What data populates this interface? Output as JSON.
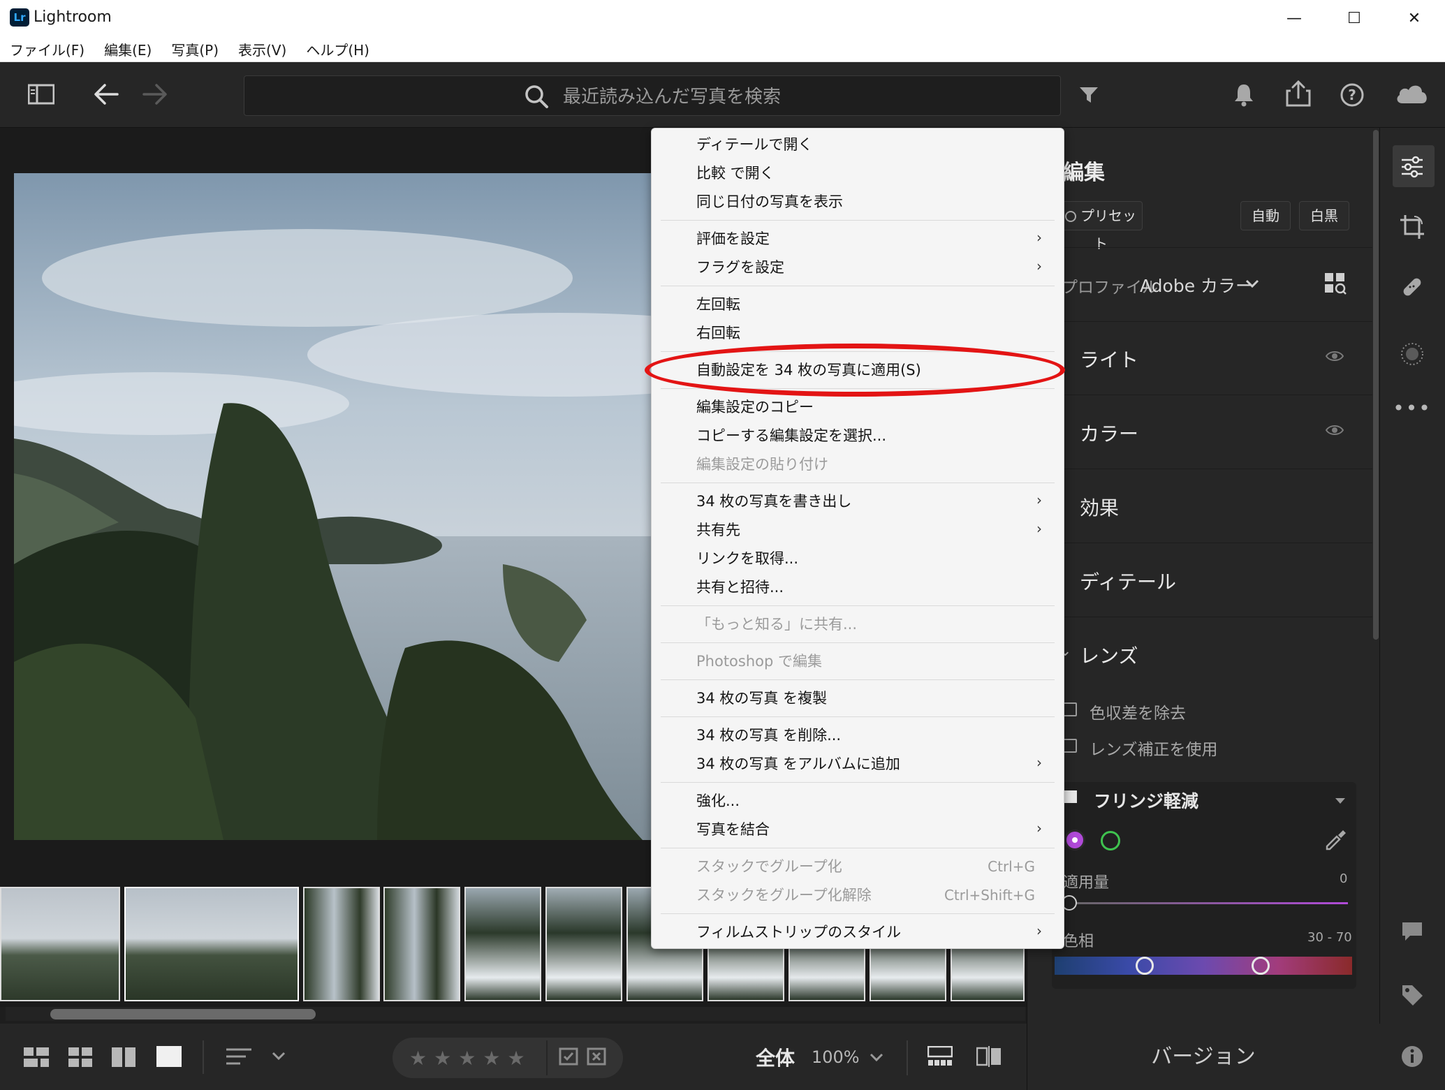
{
  "titlebar": {
    "logo": "Lr",
    "title": "Lightroom",
    "minimize": "—",
    "maximize": "☐",
    "close": "✕"
  },
  "menubar": {
    "items": [
      {
        "label": "ファイル(F)"
      },
      {
        "label": "編集(E)"
      },
      {
        "label": "写真(P)"
      },
      {
        "label": "表示(V)"
      },
      {
        "label": "ヘルプ(H)"
      }
    ]
  },
  "toolbar": {
    "search_placeholder": "最近読み込んだ写真を検索"
  },
  "context_menu": {
    "items": [
      {
        "label": "ディテールで開く"
      },
      {
        "label": "比較 で開く"
      },
      {
        "label": "同じ日付の写真を表示"
      },
      {
        "label": "評価を設定"
      },
      {
        "label": "フラグを設定"
      },
      {
        "label": "左回転"
      },
      {
        "label": "右回転"
      },
      {
        "label": "自動設定を 34 枚の写真に適用(S)"
      },
      {
        "label": "編集設定のコピー"
      },
      {
        "label": "コピーする編集設定を選択..."
      },
      {
        "label": "編集設定の貼り付け"
      },
      {
        "label": "34 枚の写真を書き出し"
      },
      {
        "label": "共有先"
      },
      {
        "label": "リンクを取得..."
      },
      {
        "label": "共有と招待..."
      },
      {
        "label": "「もっと知る」に共有..."
      },
      {
        "label": "Photoshop で編集"
      },
      {
        "label": "34 枚の写真 を複製"
      },
      {
        "label": "34 枚の写真 を削除..."
      },
      {
        "label": "34 枚の写真 をアルバムに追加"
      },
      {
        "label": "強化..."
      },
      {
        "label": "写真を結合"
      },
      {
        "label": "スタックでグループ化",
        "shortcut": "Ctrl+G"
      },
      {
        "label": "スタックをグループ化解除",
        "shortcut": "Ctrl+Shift+G"
      },
      {
        "label": "フィルムストリップのスタイル"
      }
    ],
    "submenu_arrow": "›"
  },
  "edit_panel": {
    "title": "編集",
    "preset_label": "プリセット",
    "auto_label": "自動",
    "bw_label": "白黒",
    "profile_label": "プロファイル",
    "profile_value": "Adobe カラー",
    "sections": [
      {
        "label": "ライト"
      },
      {
        "label": "カラー"
      },
      {
        "label": "効果"
      },
      {
        "label": "ディテール"
      },
      {
        "label": "レンズ"
      }
    ],
    "lens": {
      "remove_ca": "色収差を除去",
      "enable_correction": "レンズ補正を使用",
      "defringe_title": "フリンジ軽減",
      "amount_label": "適用量",
      "amount_value": "0",
      "hue_label": "色相",
      "hue_value": "30 - 70"
    }
  },
  "bottom_bar": {
    "fit_label": "全体",
    "zoom_label": "100%",
    "version_label": "バージョン",
    "stars": [
      "★",
      "★",
      "★",
      "★",
      "★"
    ]
  },
  "colors": {
    "accent_red": "#e31414",
    "purple_swatch": "#b04ad8",
    "green_swatch": "#3fc24f"
  }
}
